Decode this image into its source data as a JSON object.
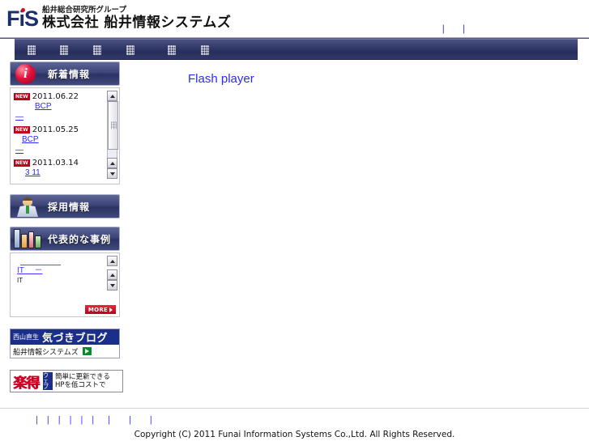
{
  "header": {
    "logo_text": "FiS",
    "company_small": "船井総合研究所グループ",
    "company_large": "株式会社 船井情報システムズ",
    "util_links": [
      "",
      ""
    ]
  },
  "nav": {
    "items": [
      {
        "name": "nav-item-1",
        "label": ""
      },
      {
        "name": "nav-item-2",
        "label": ""
      },
      {
        "name": "nav-item-3",
        "label": ""
      },
      {
        "name": "nav-item-4",
        "label": ""
      },
      {
        "name": "nav-item-5",
        "label": ""
      },
      {
        "name": "nav-item-6",
        "label": ""
      }
    ]
  },
  "sidebar": {
    "news_panel": {
      "title": "新着情報",
      "icon": "info-circle-icon",
      "items": [
        {
          "badge": "NEW",
          "date": "2011.06.22",
          "link": "BCP",
          "sub": "―"
        },
        {
          "badge": "NEW",
          "date": "2011.05.25",
          "link": "BCP",
          "sub": "―"
        },
        {
          "badge": "NEW",
          "date": "2011.03.14",
          "link": "3 11",
          "sub": ""
        }
      ]
    },
    "recruit_panel": {
      "title": "採用情報",
      "icon": "businessman-icon"
    },
    "case_panel": {
      "title": "代表的な事例",
      "icon": "bar-chart-icon",
      "links": [
        "",
        "IT　 －"
      ],
      "note": "IT",
      "more_label": "MORE"
    },
    "blog_banner": {
      "author": "西山直生",
      "title": "気づきブログ",
      "subtitle": "船井情報システムズ"
    },
    "raku_banner": {
      "mark": "楽得",
      "vertical": "ウェブ",
      "line1": "簡単に更新できる",
      "line2": "HPを低コストで"
    }
  },
  "main": {
    "flash_text": "Flash player"
  },
  "footer": {
    "links": [
      "",
      "",
      "",
      "",
      "",
      "",
      "",
      "",
      ""
    ],
    "copyright": "Copyright (C) 2011 Funai Information Systems Co.,Ltd. All Rights Reserved."
  },
  "colors": {
    "nav_bg": "#2e3566",
    "panel_head": "#3c4478",
    "link_blue": "#2a2aff",
    "badge_red": "#c00018",
    "blog_blue": "#1b2f8a"
  }
}
